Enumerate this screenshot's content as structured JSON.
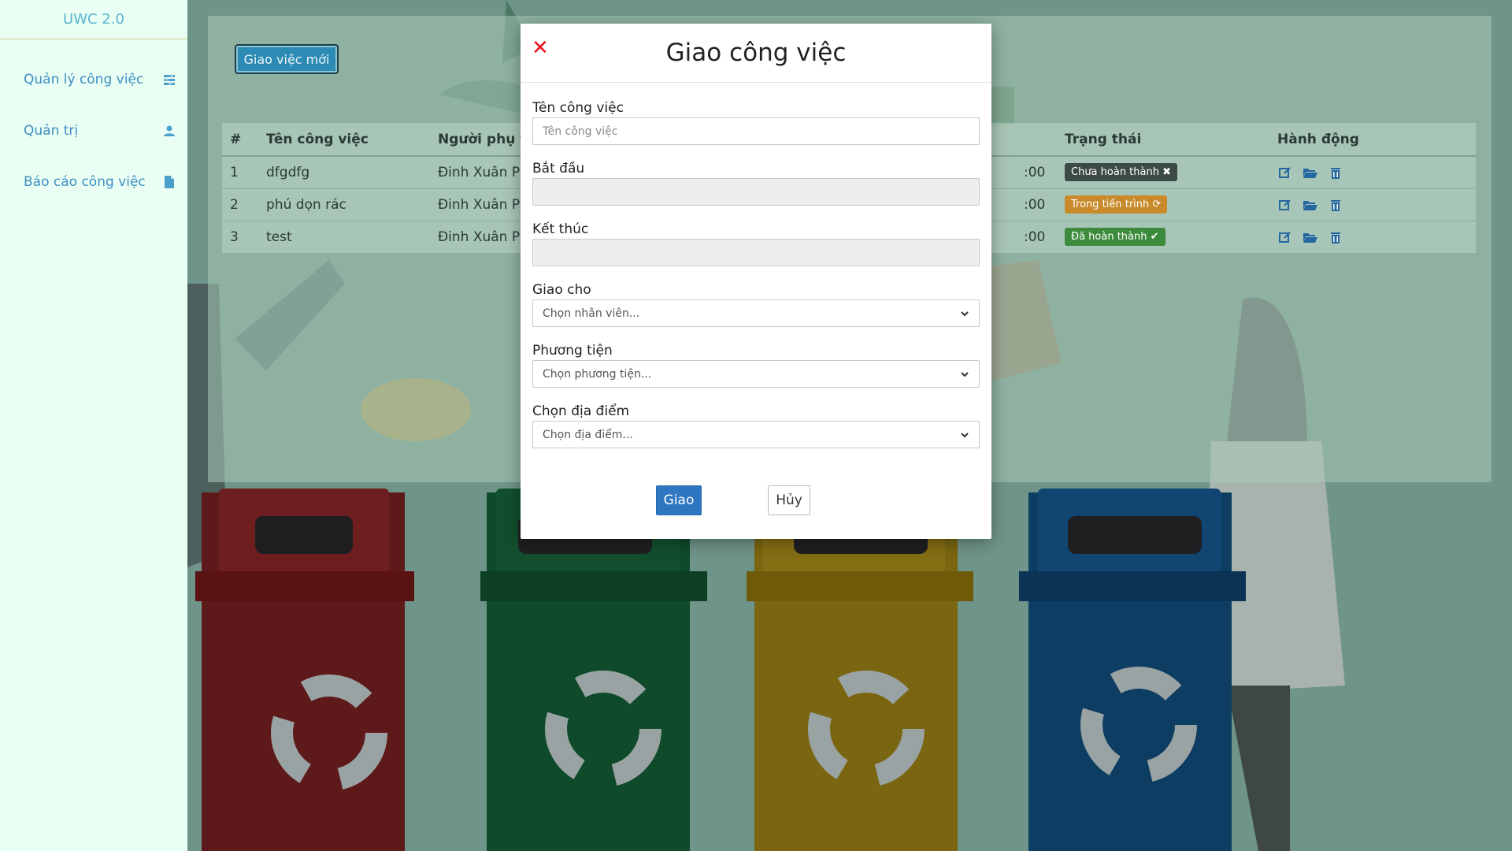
{
  "sidebar": {
    "brand": "UWC 2.0",
    "items": [
      {
        "label": "Quản lý công việc",
        "icon": "tasks-icon"
      },
      {
        "label": "Quản trị",
        "icon": "user-icon"
      },
      {
        "label": "Báo cáo công việc",
        "icon": "document-icon"
      }
    ]
  },
  "toolbar": {
    "new_task_label": "Giao việc mới"
  },
  "table": {
    "headers": [
      "#",
      "Tên công việc",
      "Người phụ tr",
      "",
      "Trạng thái",
      "Hành động"
    ],
    "rows": [
      {
        "index": "1",
        "name": "dfgdfg",
        "assignee": "Đinh Xuân Ph",
        "time": ":00",
        "status": "Chưa hoàn thành",
        "status_color": "#3e4a47",
        "status_icon": "✖"
      },
      {
        "index": "2",
        "name": "phú dọn rác",
        "assignee": "Đinh Xuân Ph",
        "time": ":00",
        "status": "Trong tiến trình",
        "status_color": "#c88a2a",
        "status_icon": "⟳"
      },
      {
        "index": "3",
        "name": "test",
        "assignee": "Đinh Xuân Ph",
        "time": ":00",
        "status": "Đã hoàn thành",
        "status_color": "#3c8a3b",
        "status_icon": "✔"
      }
    ]
  },
  "modal": {
    "title": "Giao công việc",
    "close_symbol": "✕",
    "fields": {
      "task_name": {
        "label": "Tên công việc",
        "placeholder": "Tên công việc",
        "value": ""
      },
      "start": {
        "label": "Bắt đầu",
        "value": ""
      },
      "end": {
        "label": "Kết thúc",
        "value": ""
      },
      "assign_to": {
        "label": "Giao cho",
        "selected": "Chọn nhân viên..."
      },
      "vehicle": {
        "label": "Phương tiện",
        "selected": "Chọn phương tiện..."
      },
      "location": {
        "label": "Chọn địa điểm",
        "selected": "Chọn địa điểm..."
      }
    },
    "submit_label": "Giao",
    "cancel_label": "Hủy"
  },
  "colors": {
    "accent": "#2f76c0",
    "close": "#e8141b",
    "sidebar_text": "#3f8ec3",
    "brand": "#5ab4cf"
  }
}
